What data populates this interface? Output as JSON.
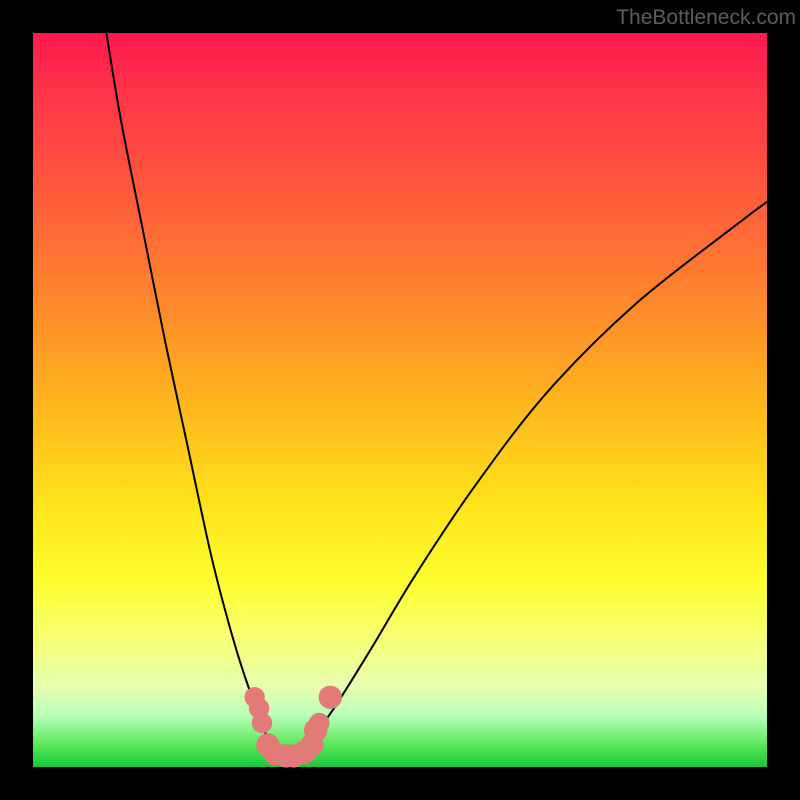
{
  "watermark": "TheBottleneck.com",
  "chart_data": {
    "type": "line",
    "title": "",
    "xlabel": "",
    "ylabel": "",
    "xlim": [
      0,
      100
    ],
    "ylim": [
      0,
      100
    ],
    "colors": {
      "gradient_top": "#ff1850",
      "gradient_mid": "#feff30",
      "gradient_bottom": "#18c838",
      "curve": "#000000",
      "markers": "#e27b78"
    },
    "series": [
      {
        "name": "left-branch",
        "x": [
          10,
          12,
          15,
          18,
          21,
          24,
          26,
          28,
          30,
          31,
          32,
          33,
          34
        ],
        "y": [
          100,
          88,
          73,
          58,
          44,
          30,
          22,
          15,
          9,
          6,
          4,
          2.5,
          1.5
        ]
      },
      {
        "name": "right-branch",
        "x": [
          34,
          36,
          38,
          41,
          46,
          52,
          60,
          70,
          82,
          96,
          100
        ],
        "y": [
          1.5,
          2,
          4,
          8,
          16,
          26,
          38,
          51,
          63,
          74,
          77
        ]
      }
    ],
    "markers": [
      {
        "x": 30.2,
        "y": 9.5,
        "r": 1.4
      },
      {
        "x": 30.8,
        "y": 8,
        "r": 1.4
      },
      {
        "x": 31.2,
        "y": 6,
        "r": 1.4
      },
      {
        "x": 32,
        "y": 3,
        "r": 1.6
      },
      {
        "x": 33,
        "y": 1.8,
        "r": 1.6
      },
      {
        "x": 34.5,
        "y": 1.5,
        "r": 1.6
      },
      {
        "x": 35.5,
        "y": 1.5,
        "r": 1.6
      },
      {
        "x": 37,
        "y": 2,
        "r": 1.6
      },
      {
        "x": 38,
        "y": 3,
        "r": 1.6
      },
      {
        "x": 38.5,
        "y": 5,
        "r": 1.6
      },
      {
        "x": 39,
        "y": 6,
        "r": 1.4
      },
      {
        "x": 40.5,
        "y": 9.5,
        "r": 1.6
      }
    ]
  }
}
